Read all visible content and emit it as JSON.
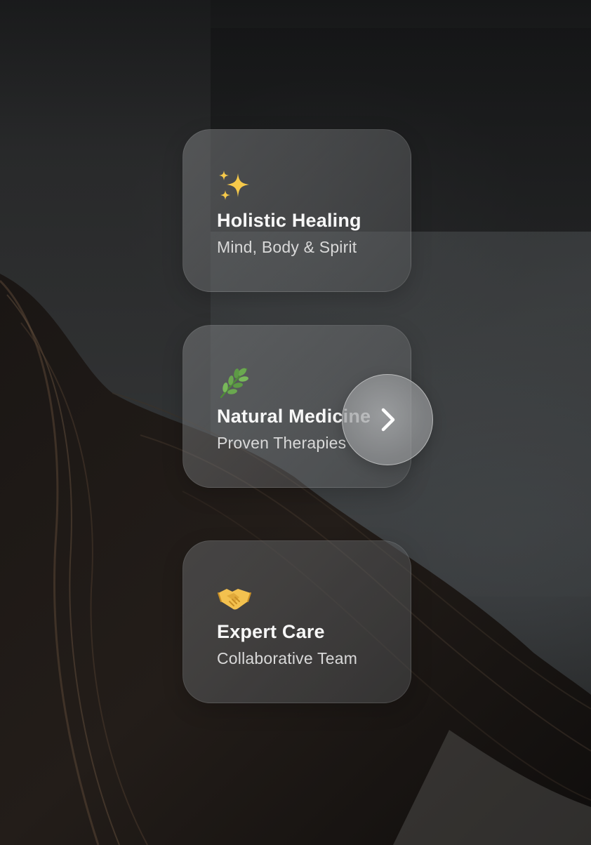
{
  "cards": [
    {
      "icon": "sparkles-icon",
      "title": "Holistic Healing",
      "subtitle": "Mind, Body & Spirit"
    },
    {
      "icon": "herb-icon",
      "title": "Natural Medicine",
      "subtitle": "Proven Therapies"
    },
    {
      "icon": "handshake-icon",
      "title": "Expert Care",
      "subtitle": "Collaborative Team"
    }
  ],
  "next_button": {
    "icon": "chevron-right-icon"
  },
  "colors": {
    "card_text": "#f7f7f7",
    "card_subtext": "#d9d9d9",
    "sparkle": "#f6c94a",
    "herb": "#6aa84f",
    "handshake": "#f3c14f"
  }
}
